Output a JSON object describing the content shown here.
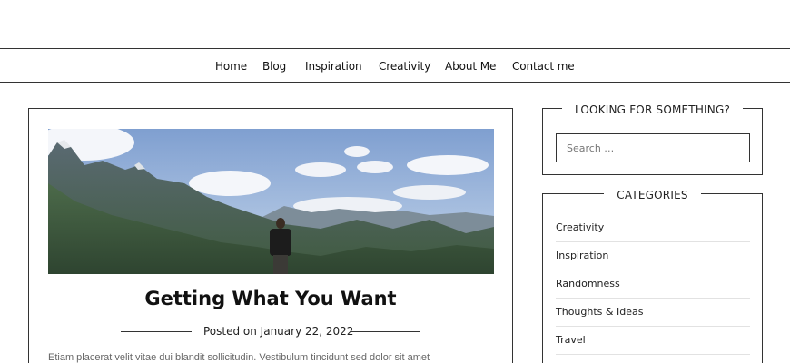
{
  "nav": {
    "items": [
      {
        "label": "Home"
      },
      {
        "label": "Blog"
      },
      {
        "label": "Inspiration"
      },
      {
        "label": "Creativity"
      },
      {
        "label": "About Me"
      },
      {
        "label": "Contact me"
      }
    ]
  },
  "post": {
    "title": "Getting What You Want",
    "meta": "Posted on January 22, 2022",
    "excerpt": "Etiam placerat velit vitae dui blandit sollicitudin. Vestibulum tincidunt sed dolor sit amet"
  },
  "sidebar": {
    "search": {
      "title": "LOOKING FOR SOMETHING?",
      "placeholder": "Search …"
    },
    "categories": {
      "title": "CATEGORIES",
      "items": [
        {
          "label": "Creativity"
        },
        {
          "label": "Inspiration"
        },
        {
          "label": "Randomness"
        },
        {
          "label": "Thoughts & Ideas"
        },
        {
          "label": "Travel"
        }
      ]
    }
  }
}
